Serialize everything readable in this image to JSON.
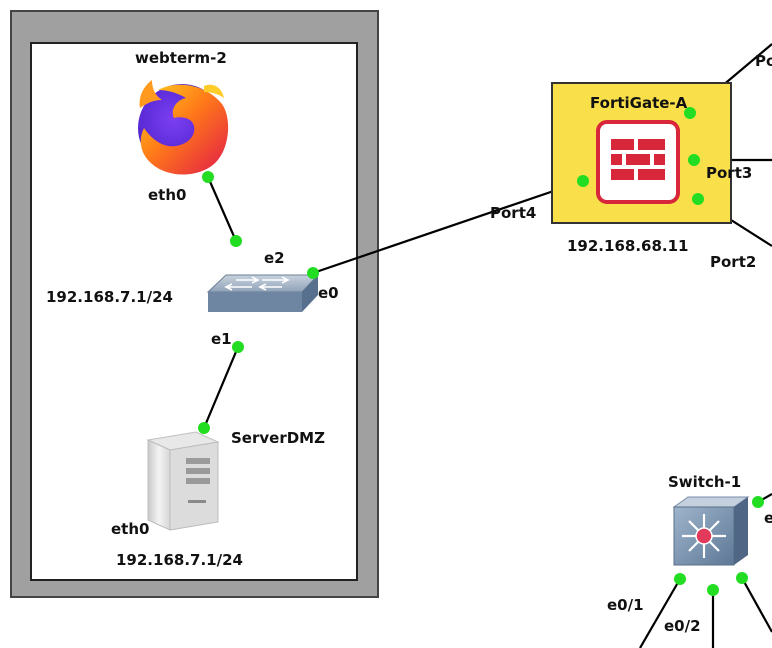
{
  "colors": {
    "zone_fill": "#a0a0a0",
    "zone_border": "#444444",
    "inner_fill": "#ffffff",
    "fortigate_fill": "#f9e04a",
    "fortigate_icon_border": "#d8263a",
    "fortigate_brick": "#d8263a",
    "link_dot": "#22dd22",
    "switch_body": "#7c95b4"
  },
  "nodes": {
    "webterm": {
      "name": "webterm-2",
      "icon": "firefox-icon",
      "iface": "eth0"
    },
    "dmz_switch": {
      "icon": "ethernet-switch-icon",
      "ip": "192.168.7.1/24",
      "ports": {
        "e0": "e0",
        "e1": "e1",
        "e2": "e2"
      }
    },
    "server": {
      "name": "ServerDMZ",
      "icon": "server-tower-icon",
      "iface": "eth0",
      "ip": "192.168.7.1/24"
    },
    "fortigate": {
      "name": "FortiGate-A",
      "icon": "firewall-icon",
      "ip": "192.168.68.11",
      "ports": {
        "port4": "Port4",
        "port3": "Port3",
        "port2": "Port2",
        "port1_partial": "Po"
      }
    },
    "switch1": {
      "name": "Switch-1",
      "icon": "multilayer-switch-icon",
      "ports": {
        "e0_1": "e0/1",
        "e0_2": "e0/2",
        "e_partial": "e"
      }
    }
  }
}
